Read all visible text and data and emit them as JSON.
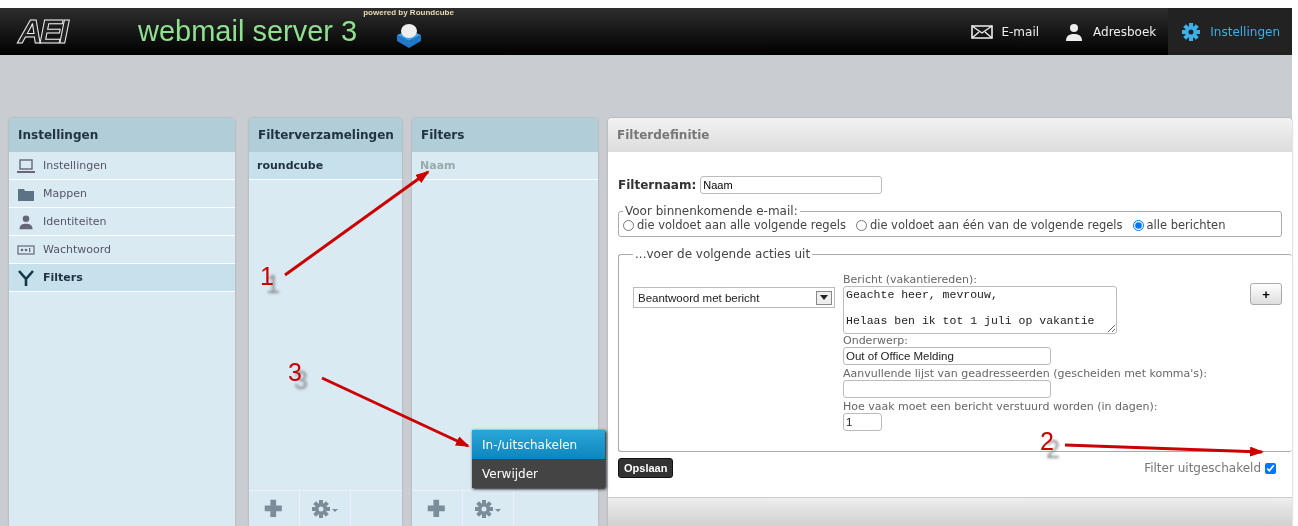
{
  "header": {
    "logo": "AEI",
    "title": "webmail server 3",
    "powered": "powered by Roundcube",
    "nav": [
      {
        "label": "E-mail",
        "kind": "mail",
        "selected": false
      },
      {
        "label": "Adresboek",
        "kind": "person",
        "selected": false
      },
      {
        "label": "Instellingen",
        "kind": "gear",
        "selected": true
      }
    ]
  },
  "settings_panel": {
    "title": "Instellingen",
    "items": [
      {
        "label": "Instellingen",
        "kind": "laptop",
        "selected": false
      },
      {
        "label": "Mappen",
        "kind": "folder",
        "selected": false
      },
      {
        "label": "Identiteiten",
        "kind": "person",
        "selected": false
      },
      {
        "label": "Wachtwoord",
        "kind": "password",
        "selected": false
      },
      {
        "label": "Filters",
        "kind": "filter",
        "selected": true
      }
    ]
  },
  "filtersets_panel": {
    "title": "Filterverzamelingen",
    "items": [
      {
        "label": "roundcube",
        "selected": true
      }
    ]
  },
  "filters_panel": {
    "title": "Filters",
    "items": [
      {
        "label": "Naam",
        "disabled": true
      }
    ]
  },
  "context_menu": {
    "items": [
      {
        "label": "In-/uitschakelen",
        "selected": true
      },
      {
        "label": "Verwijder",
        "selected": false
      }
    ]
  },
  "filter_definition": {
    "title": "Filterdefinitie",
    "name_label": "Filternaam:",
    "name_value": "Naam",
    "incoming": {
      "legend": "Voor binnenkomende e-mail:",
      "options": [
        {
          "label": "die voldoet aan alle volgende regels",
          "selected": false
        },
        {
          "label": "die voldoet aan één van de volgende regels",
          "selected": false
        },
        {
          "label": "alle berichten",
          "selected": true
        }
      ]
    },
    "actions": {
      "legend": "...voer de volgende acties uit",
      "action": "Beantwoord met bericht",
      "add_button": "+",
      "message_label": "Bericht (vakantiereden):",
      "message_value": "Geachte heer, mevrouw,\n\nHelaas ben ik tot 1 juli op vakantie",
      "subject_label": "Onderwerp:",
      "subject_value": "Out of Office Melding",
      "addresses_label": "Aanvullende lijst van geadresseerden (gescheiden met komma's):",
      "days_label": "Hoe vaak moet een bericht verstuurd worden (in dagen):",
      "days_value": "1"
    },
    "save_button": "Opslaan",
    "disabled_label": "Filter uitgeschakeld",
    "disabled_checked": true
  },
  "annotations": [
    {
      "label": "1"
    },
    {
      "label": "2"
    },
    {
      "label": "3"
    }
  ]
}
